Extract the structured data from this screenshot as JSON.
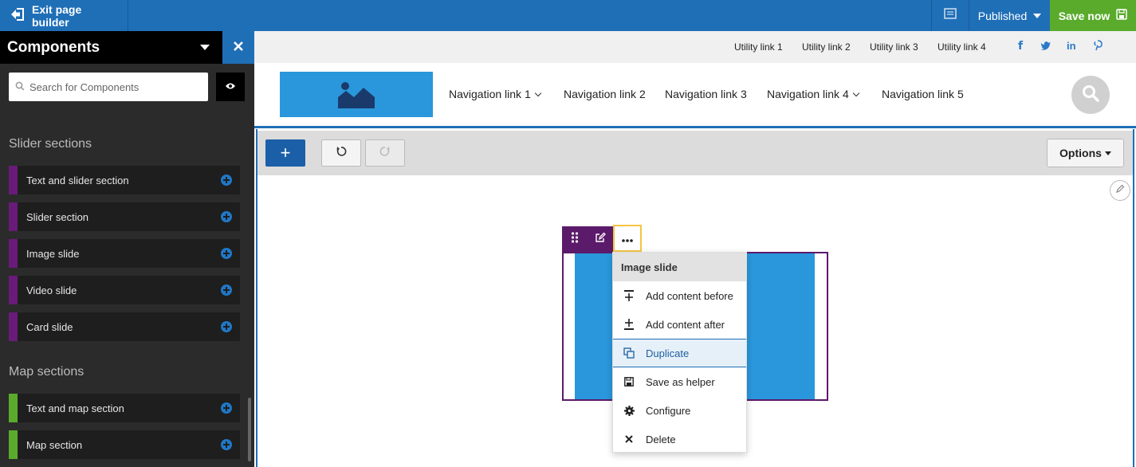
{
  "topbar": {
    "exit_label": "Exit page builder",
    "status_label": "Published",
    "save_label": "Save now"
  },
  "sidebar": {
    "title": "Components",
    "search_placeholder": "Search for Components",
    "groups": [
      {
        "title": "Slider sections",
        "color": "#6a1b7a",
        "items": [
          "Text and slider section",
          "Slider section",
          "Image slide",
          "Video slide",
          "Card slide"
        ]
      },
      {
        "title": "Map sections",
        "color": "#5aab2c",
        "items": [
          "Text and map section",
          "Map section"
        ]
      }
    ]
  },
  "site": {
    "utility_links": [
      "Utility link 1",
      "Utility link 2",
      "Utility link 3",
      "Utility link 4"
    ],
    "social_icons": [
      "facebook-icon",
      "twitter-icon",
      "linkedin-icon",
      "pinterest-icon"
    ],
    "nav_links": [
      {
        "label": "Navigation link 1",
        "has_dropdown": true
      },
      {
        "label": "Navigation link 2",
        "has_dropdown": false
      },
      {
        "label": "Navigation link 3",
        "has_dropdown": false
      },
      {
        "label": "Navigation link 4",
        "has_dropdown": true
      },
      {
        "label": "Navigation link 5",
        "has_dropdown": false
      }
    ]
  },
  "editor": {
    "add_label": "+",
    "options_label": "Options"
  },
  "context_menu": {
    "title": "Image slide",
    "items": [
      {
        "label": "Add content before",
        "icon": "insert-before-icon"
      },
      {
        "label": "Add content after",
        "icon": "insert-after-icon"
      },
      {
        "label": "Duplicate",
        "icon": "duplicate-icon",
        "active": true
      },
      {
        "label": "Save as helper",
        "icon": "save-icon"
      },
      {
        "label": "Configure",
        "icon": "gear-icon"
      },
      {
        "label": "Delete",
        "icon": "close-icon"
      }
    ]
  },
  "colors": {
    "brand_blue": "#1f6fb7",
    "save_green": "#5aab2c",
    "component_purple": "#5b1a6a",
    "image_blue": "#2a97dc"
  }
}
